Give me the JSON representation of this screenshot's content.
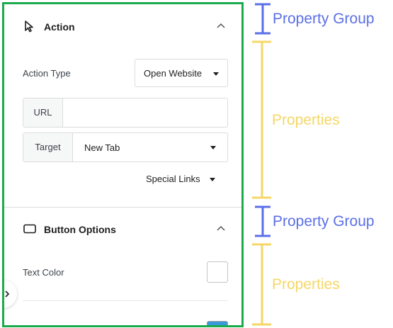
{
  "panel": {
    "action_group": {
      "title": "Action",
      "icon": "cursor-arrow-icon",
      "action_type": {
        "label": "Action Type",
        "value": "Open Website"
      },
      "url": {
        "label": "URL",
        "value": ""
      },
      "target": {
        "label": "Target",
        "value": "New Tab"
      },
      "special_links": "Special Links"
    },
    "button_options_group": {
      "title": "Button Options",
      "icon": "button-rectangle-icon",
      "text_color_label": "Text Color",
      "text_color_value": "#ffffff",
      "next_swatch_color": "#3a9ad9"
    }
  },
  "annotations": {
    "property_group": "Property Group",
    "properties": "Properties"
  },
  "colors": {
    "panel_border": "#1bab4c",
    "annotation_blue": "#5b6fe6",
    "annotation_yellow": "#f5d767"
  }
}
